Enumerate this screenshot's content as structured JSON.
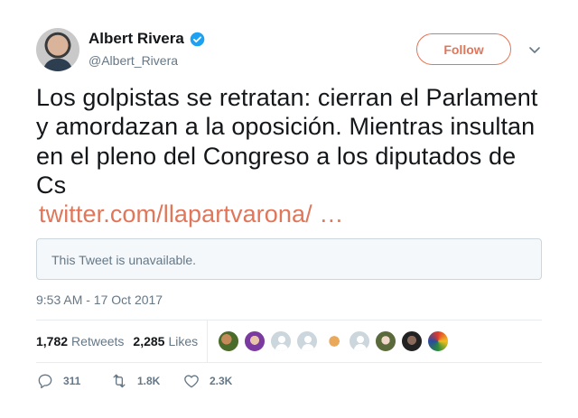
{
  "author": {
    "display_name": "Albert Rivera",
    "handle": "@Albert_Rivera",
    "verified": true
  },
  "follow_label": "Follow",
  "tweet": {
    "text": "Los golpistas se retratan: cierran el Parlament y amordazan a la oposición. Mientras insultan en el pleno del Congreso a los diputados de Cs",
    "link_text": "twitter.com/llapartvarona/ …"
  },
  "quoted": {
    "unavailable_text": "This Tweet is unavailable."
  },
  "timestamp": "9:53 AM - 17 Oct 2017",
  "stats": {
    "retweets": {
      "count": "1,782",
      "label": "Retweets"
    },
    "likes": {
      "count": "2,285",
      "label": "Likes"
    }
  },
  "actions": {
    "reply_count": "311",
    "retweet_count": "1.8K",
    "like_count": "2.3K"
  },
  "colors": {
    "accent": "#e0765a",
    "verified": "#1da1f2",
    "text_secondary": "#657786"
  },
  "icons": [
    "verified-badge-icon",
    "chevron-down-icon",
    "reply-icon",
    "retweet-icon",
    "heart-icon"
  ]
}
